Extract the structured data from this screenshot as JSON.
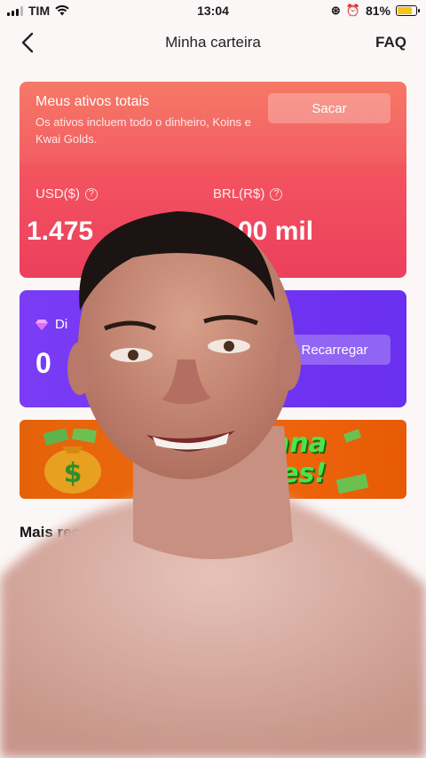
{
  "status_bar": {
    "carrier": "TIM",
    "time": "13:04",
    "battery": "81%",
    "battery_level": 0.81
  },
  "nav": {
    "title": "Minha carteira",
    "faq": "FAQ",
    "back_icon": "chevron-left-icon"
  },
  "assets": {
    "title": "Meus ativos totais",
    "description": "Os ativos incluem todo o dinheiro, Koins e Kwai Golds.",
    "withdraw": "Sacar",
    "usd_label": "USD($)",
    "usd_value": "1.475",
    "brl_label": "BRL(R$)",
    "brl_value": "00 mil",
    "info_icon": "question-icon"
  },
  "diamonds": {
    "label": "Di",
    "value": "0",
    "recharge": "Recarregar",
    "icon": "diamond-icon"
  },
  "banner": {
    "line1": "emana",
    "line2": "lives!"
  },
  "recent": {
    "title": "Mais rec"
  },
  "colors": {
    "assets_gradient_start": "#f56a55",
    "assets_gradient_end": "#ec3f5c",
    "diamond_card": "#6a2ff0",
    "banner": "#e4620a",
    "banner_text": "#4ee24e"
  }
}
